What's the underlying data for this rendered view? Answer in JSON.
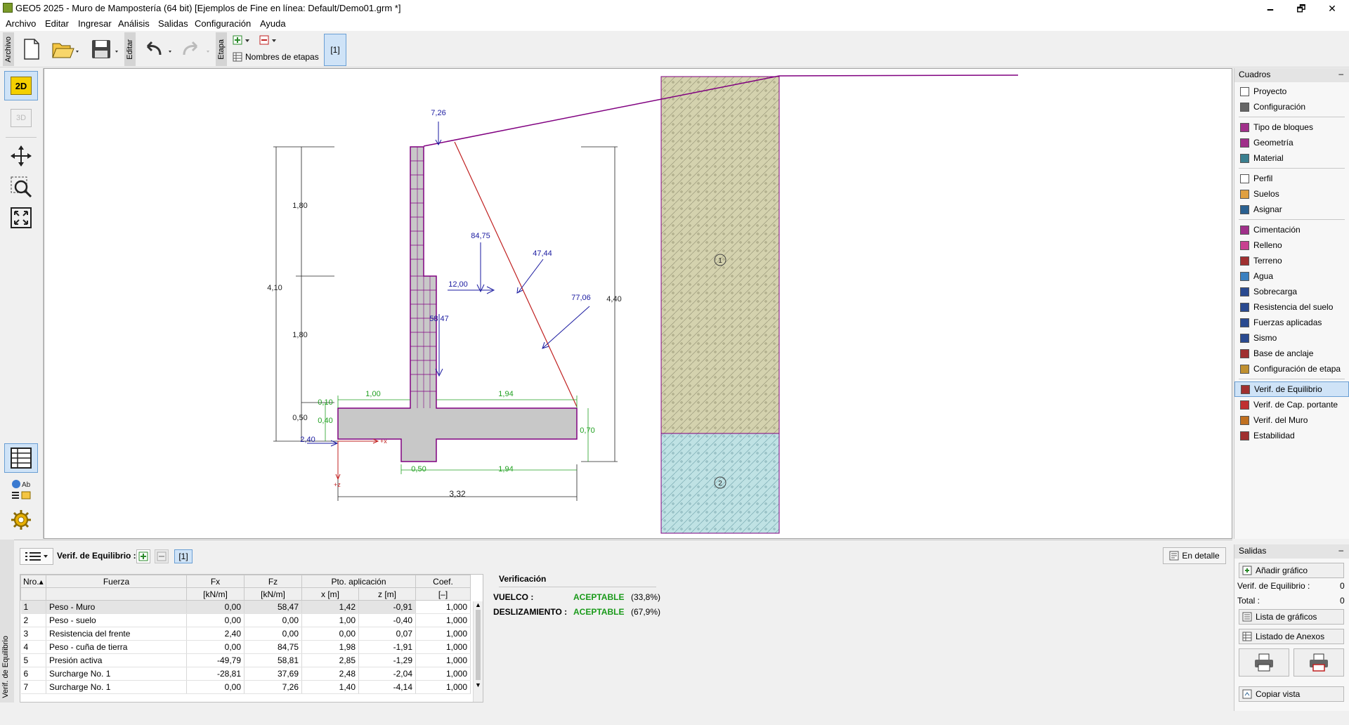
{
  "window": {
    "title": "GEO5 2025 - Muro de Mampostería (64 bit) [Ejemplos de Fine en línea: Default/Demo01.grm *]",
    "minimize": "🗕",
    "maximize": "🗗",
    "close": "✕"
  },
  "menu": [
    "Archivo",
    "Editar",
    "Ingresar",
    "Análisis",
    "Salidas",
    "Configuración",
    "Ayuda"
  ],
  "toolbar": {
    "archivo_tab": "Archivo",
    "editar_tab": "Editar",
    "etapa_tab": "Etapa",
    "stage_names_label": "Nombres de etapas",
    "stage_button": "[1]"
  },
  "left_tools": {
    "view_2d": "2D",
    "view_3d": "3D"
  },
  "drawing": {
    "dims": {
      "d_180_top": "1,80",
      "d_180_bottom": "1,80",
      "d_410": "4,10",
      "d_050": "0,50",
      "d_010": "0,10",
      "d_040": "0,40",
      "d_240": "2,40",
      "d_100": "1,00",
      "d_194_top": "1,94",
      "d_070": "0,70",
      "d_050_bottom": "0,50",
      "d_194_bottom": "1,94",
      "d_332": "3,32",
      "d_440": "4,40"
    },
    "forces": {
      "f_726": "7,26",
      "f_8475": "84,75",
      "f_4744": "47,44",
      "f_1200": "12,00",
      "f_7706": "77,06",
      "f_5847": "58,47"
    },
    "axis_x": "+x",
    "axis_z": "+z",
    "soil_1": "1",
    "soil_2": "2"
  },
  "right_panel": {
    "header": "Cuadros",
    "items": [
      {
        "label": "Proyecto",
        "icon": "project-icon",
        "color": "#ffffff"
      },
      {
        "label": "Configuración",
        "icon": "settings-icon",
        "color": "#666666"
      },
      {
        "label": "Tipo de bloques",
        "icon": "block-type-icon",
        "color": "#a0308a"
      },
      {
        "label": "Geometría",
        "icon": "geometry-icon",
        "color": "#a0308a"
      },
      {
        "label": "Material",
        "icon": "material-icon",
        "color": "#3a7f8f"
      },
      {
        "label": "Perfil",
        "icon": "profile-icon",
        "color": "#ffffff"
      },
      {
        "label": "Suelos",
        "icon": "soils-icon",
        "color": "#e0a040"
      },
      {
        "label": "Asignar",
        "icon": "assign-icon",
        "color": "#2a6090"
      },
      {
        "label": "Cimentación",
        "icon": "foundation-icon",
        "color": "#a0308a"
      },
      {
        "label": "Relleno",
        "icon": "backfill-icon",
        "color": "#c84090"
      },
      {
        "label": "Terreno",
        "icon": "terrain-icon",
        "color": "#a03030"
      },
      {
        "label": "Agua",
        "icon": "water-icon",
        "color": "#3a80c0"
      },
      {
        "label": "Sobrecarga",
        "icon": "surcharge-icon",
        "color": "#2a4a90"
      },
      {
        "label": "Resistencia del suelo",
        "icon": "soil-resistance-icon",
        "color": "#2a4a90"
      },
      {
        "label": "Fuerzas aplicadas",
        "icon": "applied-forces-icon",
        "color": "#2a4a90"
      },
      {
        "label": "Sismo",
        "icon": "earthquake-icon",
        "color": "#2a4a90"
      },
      {
        "label": "Base de anclaje",
        "icon": "anchor-base-icon",
        "color": "#a03030"
      },
      {
        "label": "Configuración de etapa",
        "icon": "stage-settings-icon",
        "color": "#c09030"
      },
      {
        "label": "Verif. de Equilibrio",
        "icon": "equilibrium-icon",
        "color": "#a03030"
      },
      {
        "label": "Verif. de Cap. portante",
        "icon": "bearing-capacity-icon",
        "color": "#c03030"
      },
      {
        "label": "Verif. del Muro",
        "icon": "wall-check-icon",
        "color": "#c07020"
      },
      {
        "label": "Estabilidad",
        "icon": "stability-icon",
        "color": "#a03030"
      }
    ]
  },
  "bottom": {
    "vertical_tab": "Verif. de Equilibrio",
    "analysis_label": "Verif. de Equilibrio :",
    "stage_btn": "[1]",
    "detail_btn": "En detalle",
    "table": {
      "headers": {
        "nro": "Nro.",
        "fuerza": "Fuerza",
        "fx": "Fx",
        "fz": "Fz",
        "pto": "Pto. aplicación",
        "coef": "Coef."
      },
      "units": {
        "fx": "[kN/m]",
        "fz": "[kN/m]",
        "x": "x [m]",
        "z": "z [m]",
        "coef": "[–]"
      },
      "rows": [
        {
          "nro": "1",
          "fuerza": "Peso - Muro",
          "fx": "0,00",
          "fz": "58,47",
          "x": "1,42",
          "z": "-0,91",
          "coef": "1,000"
        },
        {
          "nro": "2",
          "fuerza": "Peso - suelo",
          "fx": "0,00",
          "fz": "0,00",
          "x": "1,00",
          "z": "-0,40",
          "coef": "1,000"
        },
        {
          "nro": "3",
          "fuerza": "Resistencia del frente",
          "fx": "2,40",
          "fz": "0,00",
          "x": "0,00",
          "z": "0,07",
          "coef": "1,000"
        },
        {
          "nro": "4",
          "fuerza": "Peso - cuña de tierra",
          "fx": "0,00",
          "fz": "84,75",
          "x": "1,98",
          "z": "-1,91",
          "coef": "1,000"
        },
        {
          "nro": "5",
          "fuerza": "Presión activa",
          "fx": "-49,79",
          "fz": "58,81",
          "x": "2,85",
          "z": "-1,29",
          "coef": "1,000"
        },
        {
          "nro": "6",
          "fuerza": "Surcharge No. 1",
          "fx": "-28,81",
          "fz": "37,69",
          "x": "2,48",
          "z": "-2,04",
          "coef": "1,000"
        },
        {
          "nro": "7",
          "fuerza": "Surcharge No. 1",
          "fx": "0,00",
          "fz": "7,26",
          "x": "1,40",
          "z": "-4,14",
          "coef": "1,000"
        }
      ]
    },
    "verification": {
      "title": "Verificación",
      "vuelco_label": "VUELCO :",
      "vuelco_status": "ACEPTABLE",
      "vuelco_pct": "(33,8%)",
      "desl_label": "DESLIZAMIENTO :",
      "desl_status": "ACEPTABLE",
      "desl_pct": "(67,9%)",
      "status_color": "#1a9a1a"
    }
  },
  "salidas": {
    "header": "Salidas",
    "add_graph": "Añadir gráfico",
    "verif_label": "Verif. de Equilibrio :",
    "verif_count": "0",
    "total_label": "Total :",
    "total_count": "0",
    "graph_list": "Lista de gráficos",
    "annex_list": "Listado de Anexos",
    "copy_view": "Copiar vista"
  }
}
